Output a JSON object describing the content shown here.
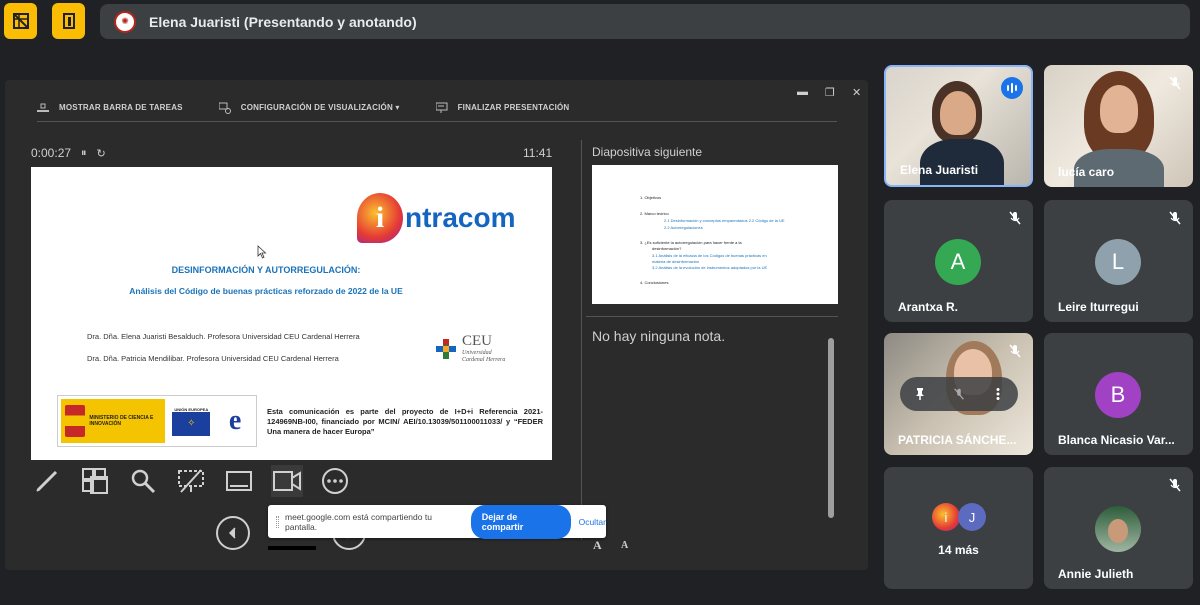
{
  "topbar": {
    "presenter_title": "Elena Juaristi (Presentando y anotando)",
    "btn1_icon": "layout-grid-off-icon",
    "btn2_icon": "exit-door-icon"
  },
  "presenter_view": {
    "toolbar": {
      "taskbar": "MOSTRAR BARRA DE TAREAS",
      "display": "CONFIGURACIÓN DE VISUALIZACIÓN ▾",
      "end": "FINALIZAR PRESENTACIÓN"
    },
    "timer": "0:00:27",
    "clock": "11:41",
    "next_label": "Diapositiva siguiente",
    "notes": "No hay ninguna nota.",
    "font_increase": "A",
    "font_decrease": "A"
  },
  "slide": {
    "logo_letter": "i",
    "logo_text": "ntracom",
    "title1": "DESINFORMACIÓN Y AUTORREGULACIÓN:",
    "title2": "Análisis del Código de buenas prácticas reforzado de 2022 de la UE",
    "author1": "Dra. Dña. Elena Juaristi Besalduch. Profesora Universidad CEU Cardenal Herrera",
    "author2": "Dra. Dña. Patricia Mendilibar. Profesora Universidad CEU Cardenal Herrera",
    "ceu_name": "CEU",
    "ceu_sub1": "Universidad",
    "ceu_sub2": "Cardenal Herrera",
    "ministry": "MINISTERIO DE CIENCIA E INNOVACIÓN",
    "eu_label": "UNIÓN EUROPEA",
    "aei_letter": "e",
    "funding_text": "Esta comunicación es parte del proyecto de I+D+i Referencia 2021-124969NB-I00, financiado por MCIN/ AEI/10.13039/501100011033/ y “FEDER Una manera de hacer Europa”"
  },
  "next_slide": {
    "lines": [
      {
        "text": "1.     Objetivos",
        "blue": false
      },
      {
        "text": "2.     Marco teórico",
        "blue": false
      },
      {
        "text": "2.1 Desinformación y conceptos emparentados 2.2 Código de la UE",
        "blue": true
      },
      {
        "text": "2.2 Autorregulaciones",
        "blue": true
      },
      {
        "text": "3.     ¿Es suficiente la autorregulación para hacer frente a la",
        "blue": false
      },
      {
        "text": "desinformación?",
        "blue": false
      },
      {
        "text": "3.1 Análisis de la eficacia de los Códigos de buenas prácticas en",
        "blue": true
      },
      {
        "text": "materia de desinformación",
        "blue": true
      },
      {
        "text": "3.2 Análisis de la evolución de instrumentos adoptados por la UE",
        "blue": true
      },
      {
        "text": "4.     Conclusiones",
        "blue": false
      }
    ]
  },
  "sharebar": {
    "message": "meet.google.com está compartiendo tu pantalla.",
    "stop": "Dejar de compartir",
    "hide": "Ocultar"
  },
  "participants": [
    {
      "name": "Elena Juaristi"
    },
    {
      "name": "lucía caro"
    },
    {
      "name": "Arantxa R.",
      "initial": "A",
      "color": "#34a853"
    },
    {
      "name": "Leire Iturregui",
      "initial": "L",
      "color": "#8fa1ad"
    },
    {
      "name": "PATRICIA SÁNCHE..."
    },
    {
      "name": "Blanca Nicasio Var...",
      "initial": "B",
      "color": "#a142c4"
    },
    {
      "more_initial": "J",
      "more_label": "14 más"
    },
    {
      "name": "Annie Julieth"
    }
  ]
}
